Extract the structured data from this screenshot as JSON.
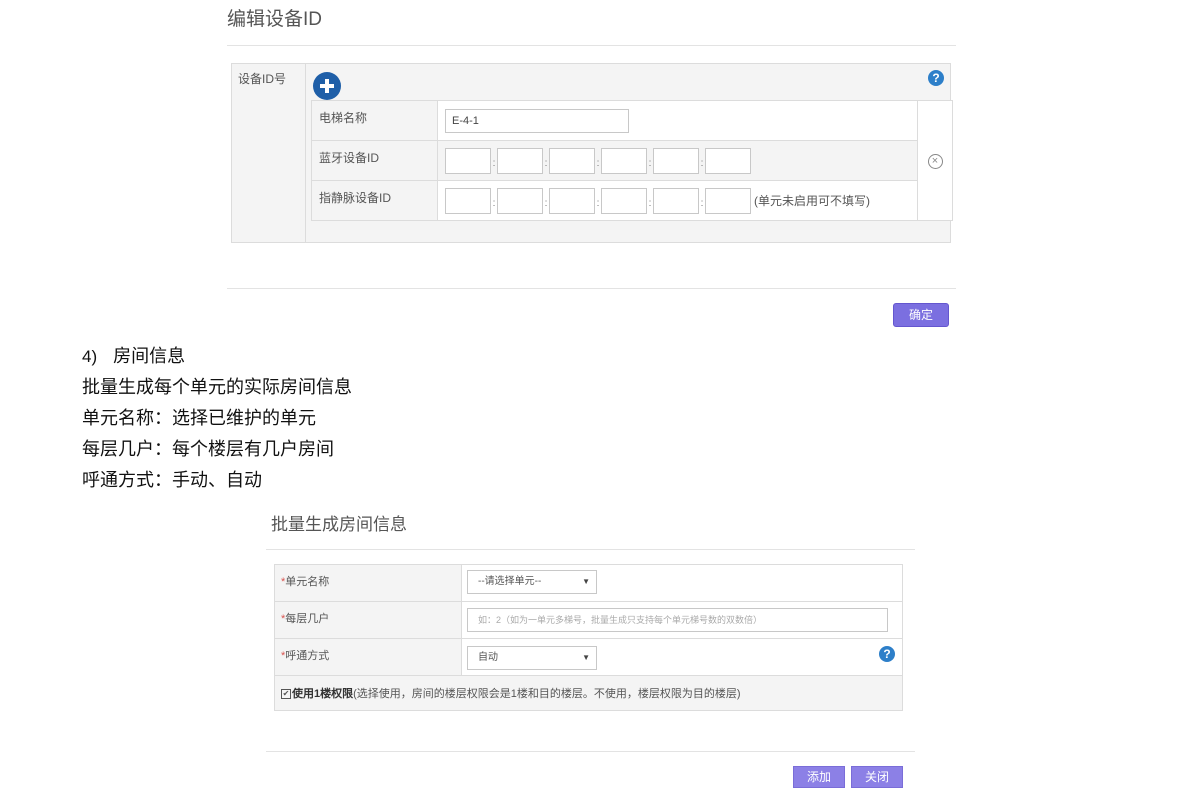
{
  "edit_dialog": {
    "title": "编辑设备ID",
    "field_label": "设备ID号",
    "help_glyph": "?",
    "rows": {
      "name": {
        "label": "电梯名称",
        "value": "E-4-1"
      },
      "bluetooth": {
        "label": "蓝牙设备ID"
      },
      "vein": {
        "label": "指静脉设备ID",
        "hint": "(单元未启用可不填写)"
      }
    },
    "segment_separator": ":",
    "remove_glyph": "×",
    "confirm_label": "确定"
  },
  "document": {
    "heading_number": "4)",
    "heading_text": "房间信息",
    "lines": [
      "批量生成每个单元的实际房间信息",
      "单元名称：选择已维护的单元",
      "每层几户：每个楼层有几户房间",
      "呼通方式：手动、自动"
    ]
  },
  "batch_dialog": {
    "title": "批量生成房间信息",
    "required_mark": "*",
    "unit": {
      "label": "单元名称",
      "selected": "--请选择单元--"
    },
    "per_floor": {
      "label": "每层几户",
      "placeholder": "如：2（如为一单元多梯号，批量生成只支持每个单元梯号数的双数倍）"
    },
    "call_mode": {
      "label": "呼通方式",
      "selected": "自动"
    },
    "help_glyph": "?",
    "check_mark": "✔",
    "floor_permission": {
      "checked": true,
      "label": "使用1楼权限",
      "description": "(选择使用，房间的楼层权限会是1楼和目的楼层。不使用，楼层权限为目的楼层)"
    },
    "add_label": "添加",
    "close_label": "关闭"
  },
  "colors": {
    "primary_button": "#7b6fe0",
    "secondary_button": "#8c80e6",
    "help_icon": "#2d7fc9",
    "add_icon": "#1f5fa8",
    "required": "#d9534f"
  }
}
